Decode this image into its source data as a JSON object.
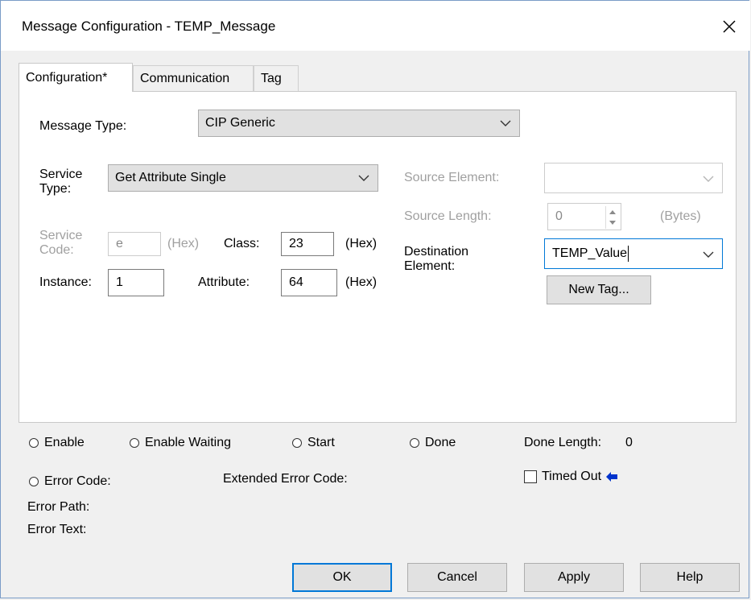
{
  "window": {
    "title": "Message Configuration - TEMP_Message"
  },
  "tabs": [
    "Configuration*",
    "Communication",
    "Tag"
  ],
  "config": {
    "message_type_label": "Message Type:",
    "message_type_value": "CIP Generic",
    "service_type_label": "Service Type:",
    "service_type_value": "Get Attribute Single",
    "service_code_label": "Service Code:",
    "service_code_value": "e",
    "service_code_unit": "(Hex)",
    "class_label": "Class:",
    "class_value": "23",
    "class_unit": "(Hex)",
    "instance_label": "Instance:",
    "instance_value": "1",
    "attribute_label": "Attribute:",
    "attribute_value": "64",
    "attribute_unit": "(Hex)",
    "source_element_label": "Source Element:",
    "source_element_value": "",
    "source_length_label": "Source Length:",
    "source_length_value": "0",
    "source_length_unit": "(Bytes)",
    "destination_element_label": "Destination Element:",
    "destination_element_value": "TEMP_Value",
    "new_tag_label": "New Tag..."
  },
  "status": {
    "enable": "Enable",
    "enable_waiting": "Enable Waiting",
    "start": "Start",
    "done": "Done",
    "done_length_label": "Done Length:",
    "done_length_value": "0",
    "error_code": "Error Code:",
    "extended_error_code": "Extended Error Code:",
    "timed_out": "Timed Out",
    "error_path": "Error Path:",
    "error_text": "Error Text:"
  },
  "buttons": {
    "ok": "OK",
    "cancel": "Cancel",
    "apply": "Apply",
    "help": "Help"
  },
  "colors": {
    "accent": "#0078d7",
    "arrow": "#0033cc"
  }
}
